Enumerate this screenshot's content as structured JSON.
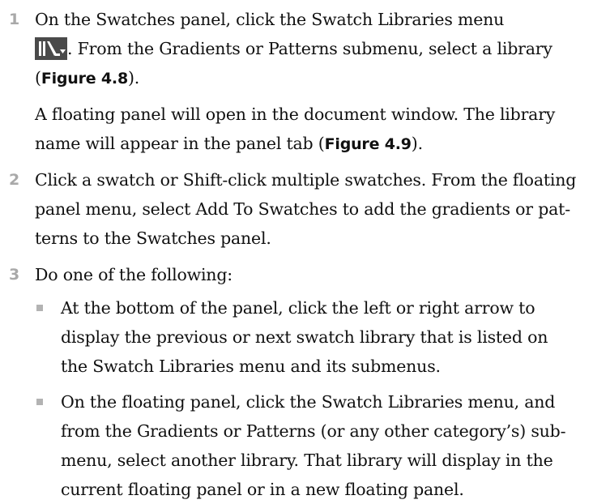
{
  "steps": [
    {
      "number": "1",
      "lines": [
        "On the Swatches panel, click the Swatch Libraries menu",
        ". From the Gradients or Patterns submenu, select a library",
        "(",
        "Figure 4.8",
        ")."
      ],
      "note": [
        "A floating panel will open in the document window. The library",
        "name will appear in the panel tab (",
        "Figure 4.9",
        ")."
      ]
    },
    {
      "number": "2",
      "lines": [
        "Click a swatch or Shift-click multiple swatches. From the floating",
        "panel menu, select Add To Swatches to add the gradients or pat-",
        "terns to the Swatches panel."
      ]
    },
    {
      "number": "3",
      "lines": [
        "Do one of the following:"
      ],
      "bullets": [
        [
          "At the bottom of the panel, click the left or right arrow to",
          "display the previous or next swatch library that is listed on",
          "the Swatch Libraries menu and its submenus."
        ],
        [
          "On the floating panel, click the Swatch Libraries menu, and",
          "from the Gradients or Patterns (or any other category’s) sub-",
          "menu, select another library. That library will display in the",
          "current floating panel or in a new floating panel."
        ]
      ]
    }
  ],
  "icons": {
    "swatch_libraries_menu": "swatch-libraries-menu-icon"
  },
  "colors": {
    "step_number": "#a9a9a9",
    "bullet": "#b3b3b3",
    "icon_bg": "#4a4a4a"
  }
}
